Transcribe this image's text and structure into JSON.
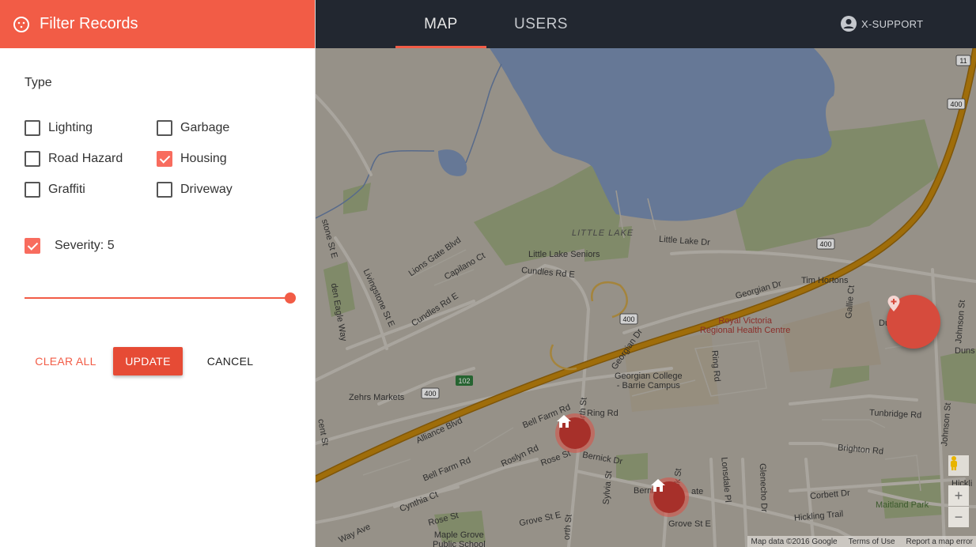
{
  "sidebar": {
    "title": "Filter Records",
    "type_label": "Type",
    "types": [
      {
        "label": "Lighting",
        "checked": false
      },
      {
        "label": "Garbage",
        "checked": false
      },
      {
        "label": "Road Hazard",
        "checked": false
      },
      {
        "label": "Housing",
        "checked": true
      },
      {
        "label": "Graffiti",
        "checked": false
      },
      {
        "label": "Driveway",
        "checked": false
      }
    ],
    "severity": {
      "label": "Severity: 5",
      "checked": true,
      "value": 5
    },
    "buttons": {
      "clear": "CLEAR ALL",
      "update": "UPDATE",
      "cancel": "CANCEL"
    }
  },
  "topbar": {
    "tabs": [
      {
        "label": "MAP",
        "active": true
      },
      {
        "label": "USERS",
        "active": false
      }
    ],
    "user": "X-SUPPORT"
  },
  "map": {
    "labels": {
      "little_lake": "LITTLE LAKE",
      "little_lake_dr": "Little Lake Dr",
      "little_lake_seniors": "Little Lake Seniors",
      "lions_gate": "Lions Gate Blvd",
      "capilano": "Capilano Ct",
      "cundles_e1": "Cundles Rd E",
      "cundles_e2": "Cundles Rd E",
      "livingstone": "Livingstone St E",
      "livingstone2": "stone St E",
      "eagle_way": "den Eagle Way",
      "georgian_dr1": "Georgian Dr",
      "georgian_dr2": "Georgian Dr",
      "tim_hortons": "Tim Hortons",
      "royal_victoria": "Royal Victoria\nRegional Health Centre",
      "georgian_college": "Georgian College\n- Barrie Campus",
      "zehrs": "Zehrs Markets",
      "bell_farm1": "Bell Farm Rd",
      "bell_farm2": "Bell Farm Rd",
      "ring_rd1": "Ring Rd",
      "ring_rd2": "Ring Rd",
      "alliance": "Alliance Blvd",
      "roslyn": "Roslyn Rd",
      "rose_st1": "Rose St",
      "rose_st2": "Rose St",
      "bernick1": "Bernick Dr",
      "bernick2": "Bernick Dr",
      "sylvia": "Sylvia St",
      "cook": "Cook St",
      "lonsdale": "Lonsdale Pl",
      "glenecho": "Glenecho Dr",
      "grove_e": "Grove St E",
      "grove_st": "Grove St E",
      "hickling": "Hickling Trail",
      "corbett": "Corbett Dr",
      "maitland": "Maitland Park",
      "brighton": "Brighton Rd",
      "tunbridge": "Tunbridge Rd",
      "johnson1": "Johnson St",
      "johnson2": "Johnson St",
      "gallie": "Gallie Ct",
      "dunsmore": "Duns",
      "du": "Du",
      "cynthia": "Cynthia Ct",
      "maple_grove": "Maple Grove\nPublic School",
      "north_st": "orth St",
      "north_st2": "orth St",
      "vincent": "cent St",
      "way": "Way Ave",
      "ate": "ate",
      "hickl": "Hickli"
    },
    "shields": [
      "11",
      "400",
      "400",
      "400",
      "400",
      "102"
    ],
    "attribution": [
      "Map data ©2016 Google",
      "Terms of Use",
      "Report a map error"
    ],
    "zoom_in": "+",
    "zoom_out": "−"
  },
  "colors": {
    "accent": "#f25c46",
    "topbar_bg": "#222730",
    "highway": "#c3860d",
    "water": "#7d93b8",
    "park": "#9da981"
  },
  "icons": [
    "filter-icon",
    "account-circle-icon",
    "add-location-icon",
    "home-icon",
    "pegman-icon"
  ]
}
